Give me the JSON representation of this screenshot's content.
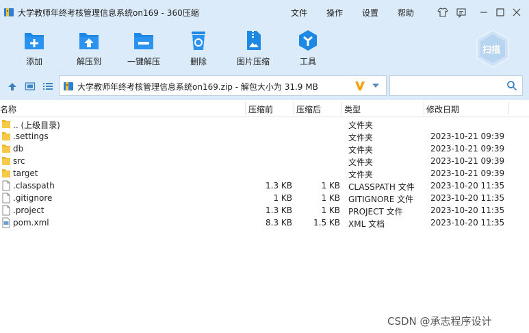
{
  "window": {
    "title": "大学教师年终考核管理信息系统on169 - 360压缩",
    "menus": [
      "文件",
      "操作",
      "设置",
      "帮助"
    ]
  },
  "toolbar": {
    "buttons": [
      {
        "label": "添加",
        "icon": "add-icon"
      },
      {
        "label": "解压到",
        "icon": "extract-to-icon"
      },
      {
        "label": "一键解压",
        "icon": "one-click-extract-icon"
      },
      {
        "label": "删除",
        "icon": "delete-icon"
      },
      {
        "label": "图片压缩",
        "icon": "image-compress-icon"
      },
      {
        "label": "工具",
        "icon": "tools-icon"
      }
    ],
    "scan_label": "扫描"
  },
  "address": {
    "path": "大学教师年终考核管理信息系统on169.zip - 解包大小为 31.9 MB",
    "search_value": ""
  },
  "columns": {
    "name": "名称",
    "size": "压缩前",
    "compressed": "压缩后",
    "type": "类型",
    "date": "修改日期"
  },
  "files": [
    {
      "name": ".. (上级目录)",
      "size": "",
      "compressed": "",
      "type": "文件夹",
      "date": "",
      "kind": "folder"
    },
    {
      "name": ".settings",
      "size": "",
      "compressed": "",
      "type": "文件夹",
      "date": "2023-10-21 09:39",
      "kind": "folder"
    },
    {
      "name": "db",
      "size": "",
      "compressed": "",
      "type": "文件夹",
      "date": "2023-10-21 09:39",
      "kind": "folder"
    },
    {
      "name": "src",
      "size": "",
      "compressed": "",
      "type": "文件夹",
      "date": "2023-10-21 09:39",
      "kind": "folder"
    },
    {
      "name": "target",
      "size": "",
      "compressed": "",
      "type": "文件夹",
      "date": "2023-10-21 09:39",
      "kind": "folder"
    },
    {
      "name": ".classpath",
      "size": "1.3 KB",
      "compressed": "1 KB",
      "type": "CLASSPATH 文件",
      "date": "2023-10-20 11:35",
      "kind": "file"
    },
    {
      "name": ".gitignore",
      "size": "1 KB",
      "compressed": "1 KB",
      "type": "GITIGNORE 文件",
      "date": "2023-10-20 11:35",
      "kind": "file"
    },
    {
      "name": ".project",
      "size": "1.3 KB",
      "compressed": "1 KB",
      "type": "PROJECT 文件",
      "date": "2023-10-20 11:35",
      "kind": "file"
    },
    {
      "name": "pom.xml",
      "size": "8.3 KB",
      "compressed": "1.5 KB",
      "type": "XML 文档",
      "date": "2023-10-20 11:35",
      "kind": "xml"
    }
  ],
  "watermark": "CSDN @承志程序设计",
  "colors": {
    "chrome_bg": "#dcebfa",
    "icon_blue": "#1e88e5",
    "folder_yellow": "#f0b429",
    "accent_orange": "#f5a000"
  }
}
